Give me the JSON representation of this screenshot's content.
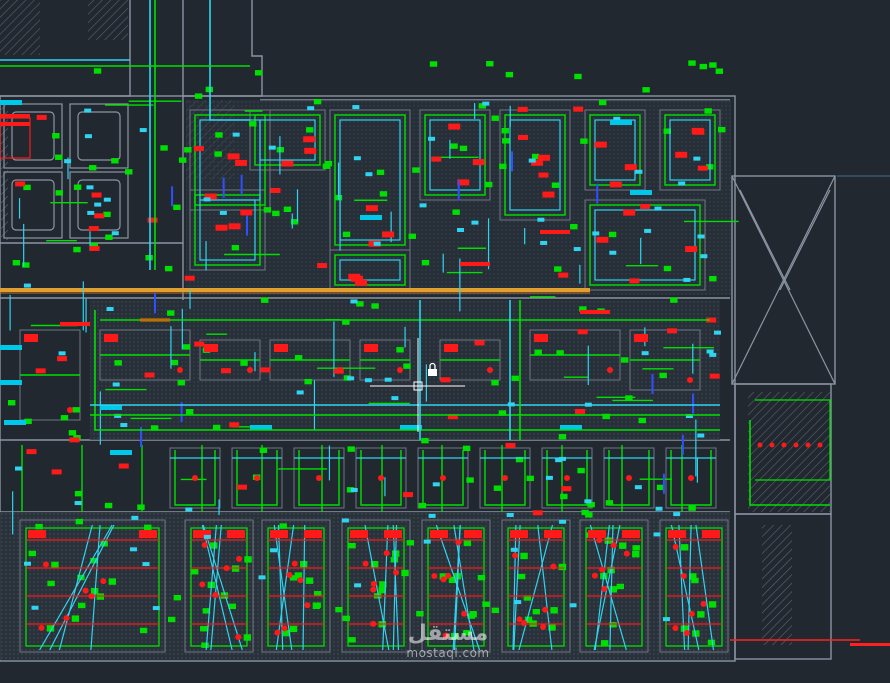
{
  "drawing": {
    "background": "#212830",
    "colors": {
      "wall": "#8b95a3",
      "hatch": "#56606b",
      "duct_supply": "#00e000",
      "duct_return": "#2fd4f0",
      "equipment": "#ff1a1a",
      "highlight": "#e0a030",
      "blue": "#3050ff",
      "label_bg": "#00c8e8"
    },
    "layers": [
      "walls",
      "hatch",
      "ducts-supply",
      "ducts-return",
      "equipment",
      "diffusers",
      "labels"
    ]
  },
  "watermark": {
    "arabic": "مستقل",
    "latin": "mostaql.com"
  },
  "cursor": {
    "type": "crosshair",
    "lock_icon": "padlock-icon"
  }
}
